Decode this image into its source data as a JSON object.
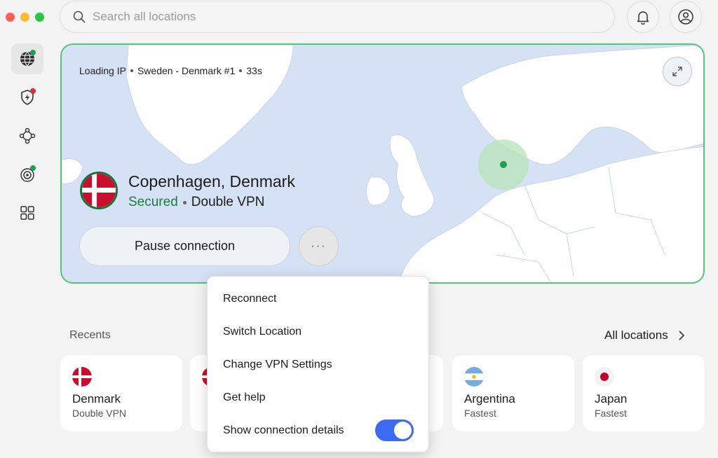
{
  "search": {
    "placeholder": "Search all locations"
  },
  "map": {
    "status": {
      "ip": "Loading IP",
      "server": "Sweden - Denmark #1",
      "time": "33s"
    }
  },
  "connection": {
    "location": "Copenhagen, Denmark",
    "state": "Secured",
    "protocol": "Double VPN",
    "pause_label": "Pause connection",
    "more_label": "···"
  },
  "recents": {
    "label": "Recents",
    "all_label": "All locations",
    "items": [
      {
        "name": "Denmark",
        "sub": "Double VPN"
      },
      {
        "name": "",
        "sub": ""
      },
      {
        "name": "",
        "sub": ""
      },
      {
        "name": "Argentina",
        "sub": "Fastest"
      },
      {
        "name": "Japan",
        "sub": "Fastest"
      }
    ]
  },
  "menu": {
    "items": [
      "Reconnect",
      "Switch Location",
      "Change VPN Settings",
      "Get help",
      "Show connection details"
    ],
    "toggle_on": true
  },
  "colors": {
    "accent_green": "#56c27a",
    "secured_green": "#1d7c3f",
    "toggle_blue": "#3b6bf0",
    "map_water": "#d5e1f5"
  }
}
